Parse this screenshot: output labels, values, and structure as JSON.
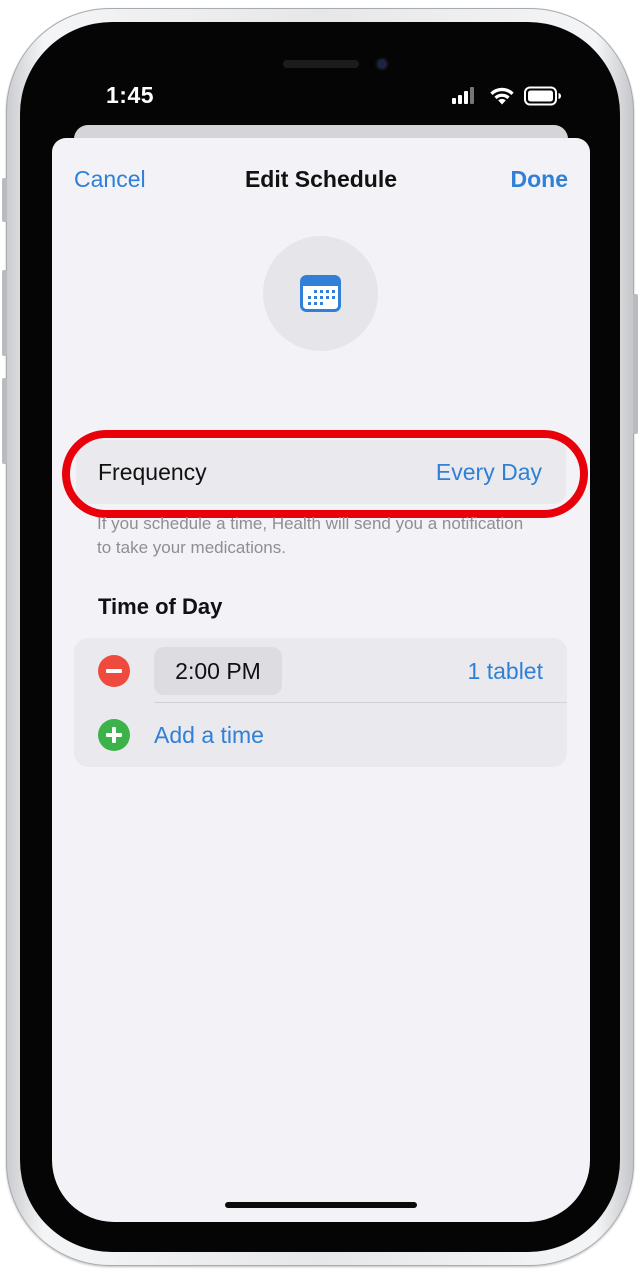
{
  "status_bar": {
    "time": "1:45",
    "icons": [
      "cellular-signal-icon",
      "wifi-icon",
      "battery-icon"
    ]
  },
  "nav": {
    "cancel_label": "Cancel",
    "title": "Edit Schedule",
    "done_label": "Done"
  },
  "header_icon": "calendar-icon",
  "frequency": {
    "label": "Frequency",
    "value": "Every Day",
    "highlighted": true
  },
  "footnote": "If you schedule a time, Health will send you a notification to take your medications.",
  "time_of_day": {
    "section_title": "Time of Day",
    "entries": [
      {
        "time": "2:00 PM",
        "dose": "1 tablet"
      }
    ],
    "add_label": "Add a time"
  },
  "colors": {
    "accent": "#2f80d6",
    "destructive": "#ee4a3e",
    "add": "#3bb34a",
    "highlight_ring": "#e8000b",
    "background": "#f2f2f7"
  }
}
